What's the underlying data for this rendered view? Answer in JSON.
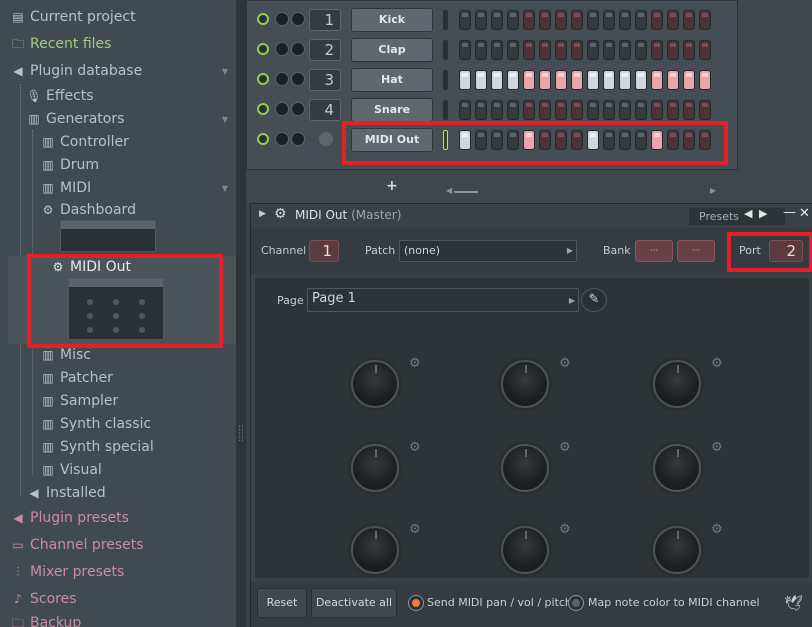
{
  "browser": {
    "items": [
      {
        "label": "Current project",
        "icon": "file-icon"
      },
      {
        "label": "Recent files",
        "icon": "folder-icon"
      },
      {
        "label": "Plugin database",
        "icon": "speaker-icon"
      },
      {
        "label": "Effects",
        "icon": "mic-icon"
      },
      {
        "label": "Generators",
        "icon": "piano-icon"
      },
      {
        "label": "Controller",
        "icon": "piano-icon"
      },
      {
        "label": "Drum",
        "icon": "piano-icon"
      },
      {
        "label": "MIDI",
        "icon": "piano-icon"
      },
      {
        "label": "Dashboard",
        "icon": "gear-icon"
      },
      {
        "label": "MIDI Out",
        "icon": "gear-icon"
      },
      {
        "label": "Misc",
        "icon": "piano-icon"
      },
      {
        "label": "Patcher",
        "icon": "piano-icon"
      },
      {
        "label": "Sampler",
        "icon": "piano-icon"
      },
      {
        "label": "Synth classic",
        "icon": "piano-icon"
      },
      {
        "label": "Synth special",
        "icon": "piano-icon"
      },
      {
        "label": "Visual",
        "icon": "piano-icon"
      },
      {
        "label": "Installed",
        "icon": "speaker-icon"
      },
      {
        "label": "Plugin presets",
        "icon": "speaker-icon"
      },
      {
        "label": "Channel presets",
        "icon": "channel-icon"
      },
      {
        "label": "Mixer presets",
        "icon": "mixer-icon"
      },
      {
        "label": "Scores",
        "icon": "note-icon"
      },
      {
        "label": "Backup",
        "icon": "folder-icon"
      }
    ]
  },
  "rack": {
    "add_label": "+",
    "channels": [
      {
        "num": "1",
        "name": "Kick",
        "steps": "0000000000000000"
      },
      {
        "num": "2",
        "name": "Clap",
        "steps": "0000000000000000"
      },
      {
        "num": "3",
        "name": "Hat",
        "steps": "wwwwppppwwwwpppp"
      },
      {
        "num": "4",
        "name": "Snare",
        "steps": "0000000000000000"
      },
      {
        "num": "",
        "name": "MIDI Out",
        "steps": "w000p000w000p000"
      }
    ],
    "colors": {
      "step_on_white": "#cfd7dd",
      "step_on_pink": "#e8a5ad",
      "led_green": "#8fd14f"
    }
  },
  "plugin": {
    "title": "MIDI Out",
    "title_suffix": "(Master)",
    "presets_label": "Presets",
    "channel_label": "Channel",
    "channel_value": "1",
    "patch_label": "Patch",
    "patch_value": "(none)",
    "bank_label": "Bank",
    "bank_btn1": "···",
    "bank_btn2": "···",
    "port_label": "Port",
    "port_value": "2",
    "page_label": "Page",
    "page_value": "Page 1",
    "reset_label": "Reset",
    "deactivate_label": "Deactivate all",
    "send_midi_label": "Send MIDI pan / vol / pitch",
    "map_note_label": "Map note color to MIDI channel"
  }
}
